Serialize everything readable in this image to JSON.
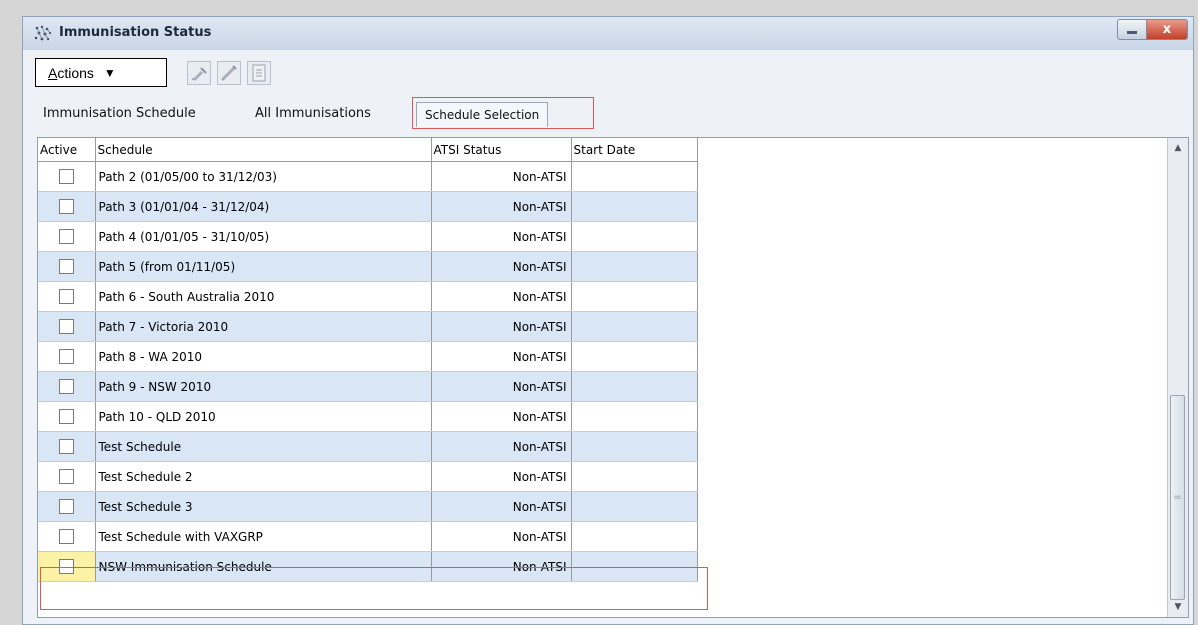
{
  "window": {
    "title": "Immunisation Status"
  },
  "toolbar": {
    "actions_label_underlined": "A",
    "actions_label_rest": "ctions",
    "actions_arrow": "▼",
    "close_glyph": "x"
  },
  "tabs": [
    {
      "label": "Immunisation Schedule",
      "active": false
    },
    {
      "label": "All Immunisations",
      "active": false
    },
    {
      "label": "Schedule Selection",
      "active": true
    }
  ],
  "table": {
    "columns": [
      "Active",
      "Schedule",
      "ATSI Status",
      "Start Date"
    ],
    "rows": [
      {
        "schedule": "Path 2 (01/05/00 to 31/12/03)",
        "status": "Non-ATSI",
        "start": ""
      },
      {
        "schedule": "Path 3 (01/01/04 - 31/12/04)",
        "status": "Non-ATSI",
        "start": ""
      },
      {
        "schedule": "Path 4 (01/01/05 - 31/10/05)",
        "status": "Non-ATSI",
        "start": ""
      },
      {
        "schedule": "Path 5 (from 01/11/05)",
        "status": "Non-ATSI",
        "start": ""
      },
      {
        "schedule": "Path 6 - South Australia 2010",
        "status": "Non-ATSI",
        "start": ""
      },
      {
        "schedule": "Path 7 - Victoria 2010",
        "status": "Non-ATSI",
        "start": ""
      },
      {
        "schedule": "Path 8 - WA 2010",
        "status": "Non-ATSI",
        "start": ""
      },
      {
        "schedule": "Path 9 - NSW 2010",
        "status": "Non-ATSI",
        "start": ""
      },
      {
        "schedule": "Path 10 - QLD 2010",
        "status": "Non-ATSI",
        "start": ""
      },
      {
        "schedule": "Test Schedule",
        "status": "Non-ATSI",
        "start": ""
      },
      {
        "schedule": "Test Schedule 2",
        "status": "Non-ATSI",
        "start": ""
      },
      {
        "schedule": "Test Schedule 3",
        "status": "Non-ATSI",
        "start": ""
      },
      {
        "schedule": "Test Schedule with VAXGRP",
        "status": "Non-ATSI",
        "start": ""
      },
      {
        "schedule": "NSW Immunisation Schedule",
        "status": "Non-ATSI",
        "start": ""
      }
    ]
  },
  "colors": {
    "row_alt": "#d8e6f6",
    "highlight": "#e05656",
    "selected_cell": "#fbf2a6"
  }
}
